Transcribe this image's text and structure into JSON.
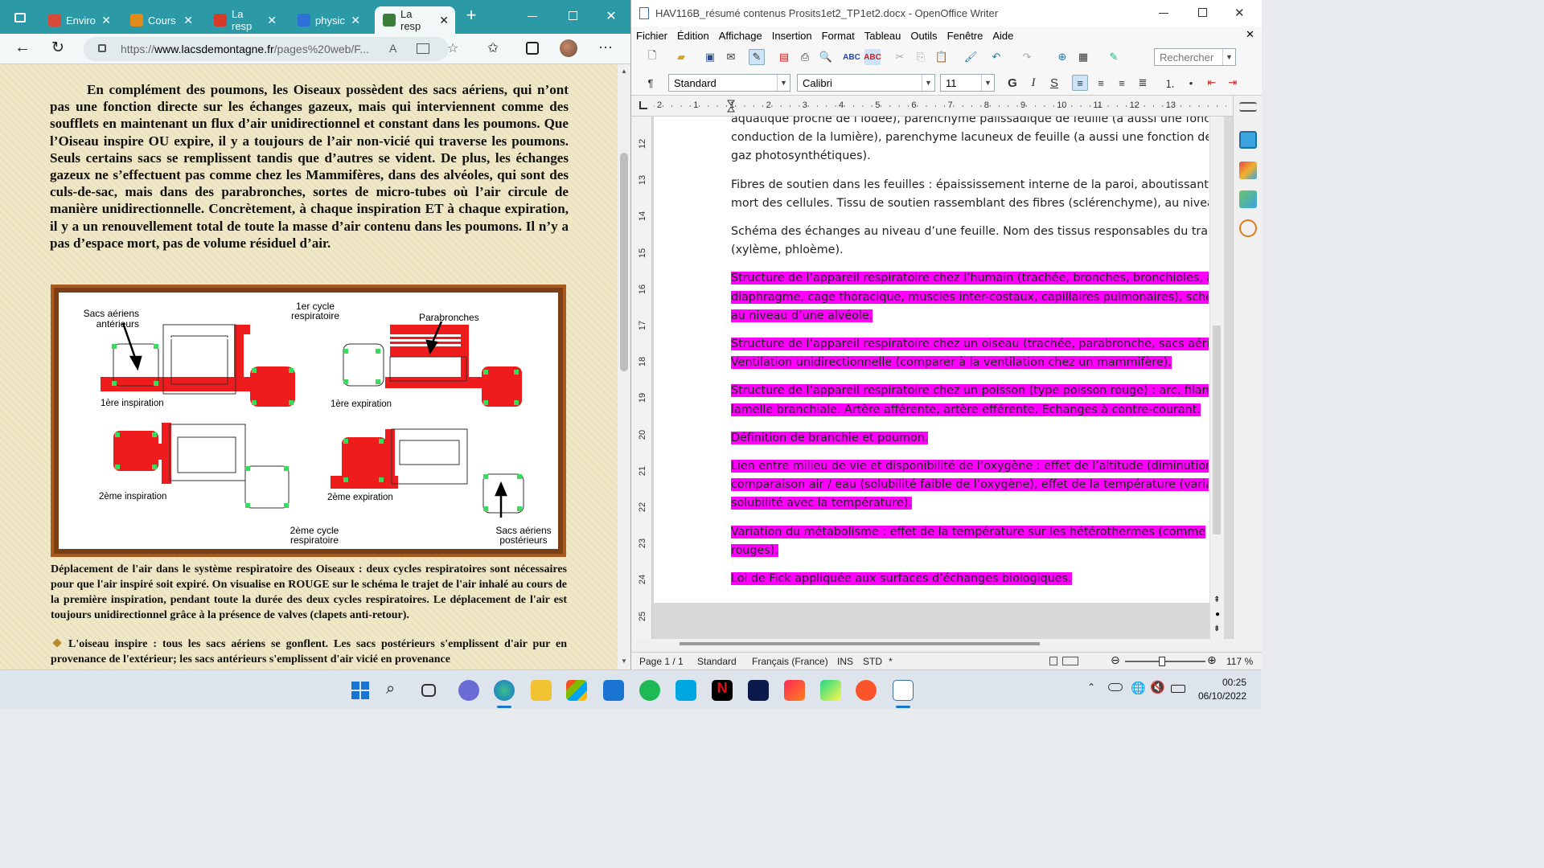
{
  "edge": {
    "tabs": [
      {
        "label": "Enviro",
        "color": "#d64a3a"
      },
      {
        "label": "Cours",
        "color": "#e08a1a"
      },
      {
        "label": "La resp",
        "color": "#d63a2a"
      },
      {
        "label": "physic",
        "color": "#2f6fd8"
      },
      {
        "label": "La resp",
        "color": "#3a7d3a",
        "active": true
      }
    ],
    "url_prefix": "https://",
    "url_host": "www.lacsdemontagne.fr",
    "url_rest": "/pages%20web/F...",
    "paragraph": "En complément des poumons, les Oiseaux possèdent des sacs aériens, qui n’ont pas une fonction directe sur les échanges gazeux, mais qui interviennent comme des soufflets en maintenant un flux d’air unidirectionnel et constant dans les poumons. Que l’Oiseau inspire OU expire, il y a toujours de l’air non-vicié qui traverse les poumons. Seuls certains sacs se remplissent tandis que d’autres se vident. De plus, les échanges gazeux ne s’effectuent pas comme chez les Mammifères, dans des alvéoles, qui sont des culs-de-sac, mais dans des parabronches, sortes de micro-tubes où l’air circule de manière unidirectionnelle. Concrètement, à chaque inspiration ET à chaque expiration, il y a un renouvellement total de toute la masse d’air contenu dans les poumons. Il n’y a pas d’espace mort, pas de volume résiduel d’air.",
    "figure": {
      "label_sacs_ant": "Sacs aériens antérieurs",
      "label_cycle1": "1er cycle respiratoire",
      "label_parabronches": "Parabronches",
      "label_insp1": "1ère inspiration",
      "label_exp1": "1ère expiration",
      "label_insp2": "2ème inspiration",
      "label_exp2": "2ème expiration",
      "label_cycle2": "2ème cycle respiratoire",
      "label_sacs_post": "Sacs aériens postérieurs"
    },
    "caption": "Déplacement de l'air dans le système respiratoire des Oiseaux : deux cycles respiratoires sont nécessaires pour que l'air inspiré soit expiré. On visualise en ROUGE sur le schéma le trajet de l'air inhalé au cours de la première inspiration, pendant toute la durée des deux cycles respiratoires. Le déplacement de l'air est toujours unidirectionnel grâce à la présence de valves (clapets anti-retour).",
    "bullet": "L'oiseau inspire : tous les sacs aériens se gonflent. Les sacs postérieurs s'emplissent d'air pur en provenance de l'extérieur; les sacs antérieurs s'emplissent d'air vicié en provenance"
  },
  "writer": {
    "title": "HAV116B_résumé contenus Prosits1et2_TP1et2.docx - OpenOffice Writer",
    "menu": [
      "Fichier",
      "Édition",
      "Affichage",
      "Insertion",
      "Format",
      "Tableau",
      "Outils",
      "Fenêtre",
      "Aide"
    ],
    "search_placeholder": "Rechercher",
    "style": "Standard",
    "font": "Calibri",
    "size": "11",
    "ruler_h": [
      "2",
      "1",
      "1",
      "2",
      "3",
      "4",
      "5",
      "6",
      "7",
      "8",
      "9",
      "10",
      "11",
      "12",
      "13"
    ],
    "ruler_v": [
      "12",
      "13",
      "14",
      "15",
      "16",
      "17",
      "18",
      "19",
      "20",
      "21",
      "22",
      "23",
      "24",
      "25"
    ],
    "paragraphs": [
      {
        "lines": [
          "aquatique proche de l’iodée), parenchyme palissadique de feuille (a aussi une fonc",
          "conduction de la lumière), parenchyme lacuneux de feuille (a aussi une fonction de",
          "gaz photosynthétiques)."
        ],
        "hl": false
      },
      {
        "lines": [
          "Fibres de soutien dans les feuilles : épaississement interne de la paroi, aboutissant f",
          "mort des cellules. Tissu de soutien rassemblant des fibres (sclérenchyme), au niveau"
        ],
        "hl": false
      },
      {
        "lines": [
          "Schéma des échanges au niveau d’une feuille. Nom des tissus responsables du trans",
          "(xylème, phloème)."
        ],
        "hl": false
      },
      {
        "lines": [
          "Structure de l’appareil respiratoire chez l’humain (trachée, bronches, bronchioles, a",
          "diaphragme, cage thoracique, muscles inter-costaux, capillaires pulmonaires), schér",
          "au niveau d’une alvéole."
        ],
        "hl": true
      },
      {
        "lines": [
          "Structure de l’appareil respiratoire chez un oiseau (trachée, parabronche, sacs aérie",
          "Ventilation unidirectionnelle (comparer à la ventilation chez un mammifère)."
        ],
        "hl": true
      },
      {
        "lines": [
          "Structure de l’appareil respiratoire chez un poisson (type poisson rouge) : arc, filam",
          "lamelle branchiale. Artère afférente, artère efférente. Echanges à contre-courant."
        ],
        "hl": true
      },
      {
        "lines": [
          "Définition de branchie et poumon."
        ],
        "hl": true
      },
      {
        "lines": [
          "Lien entre milieu de vie et disponibilité de l’oxygène : effet de l’altitude (diminution",
          "comparaison air / eau (solubilité faible de l’oxygène), effet de la température (varia",
          "solubilité avec la température)."
        ],
        "hl": true
      },
      {
        "lines": [
          "Variation du métabolisme : effet de la température sur les hétérothermes (comme",
          "rouges)."
        ],
        "hl": true
      },
      {
        "lines": [
          "Loi de Fick appliquée aux surfaces d’échanges biologiques."
        ],
        "hl": true
      }
    ],
    "status": {
      "page": "Page 1 / 1",
      "style": "Standard",
      "language": "Français (France)",
      "ins": "INS",
      "std": "STD",
      "modified": "*",
      "zoom": "117 %"
    }
  },
  "taskbar": {
    "time": "00:25",
    "date": "06/10/2022",
    "apps": [
      "start-button",
      "search",
      "task-view",
      "chat",
      "edge",
      "file-explorer",
      "microsoft-store",
      "mail",
      "spotify",
      "prime-video",
      "netflix",
      "disney-plus",
      "jetbrains",
      "pycharm",
      "brave",
      "openoffice-writer"
    ]
  },
  "colors": {
    "edge_accent": "#2c9aa6",
    "highlight": "#ff00ff",
    "figure_red": "#ee1c1c",
    "figure_green": "#3bdc5c",
    "page_beige": "#efe7c6"
  }
}
